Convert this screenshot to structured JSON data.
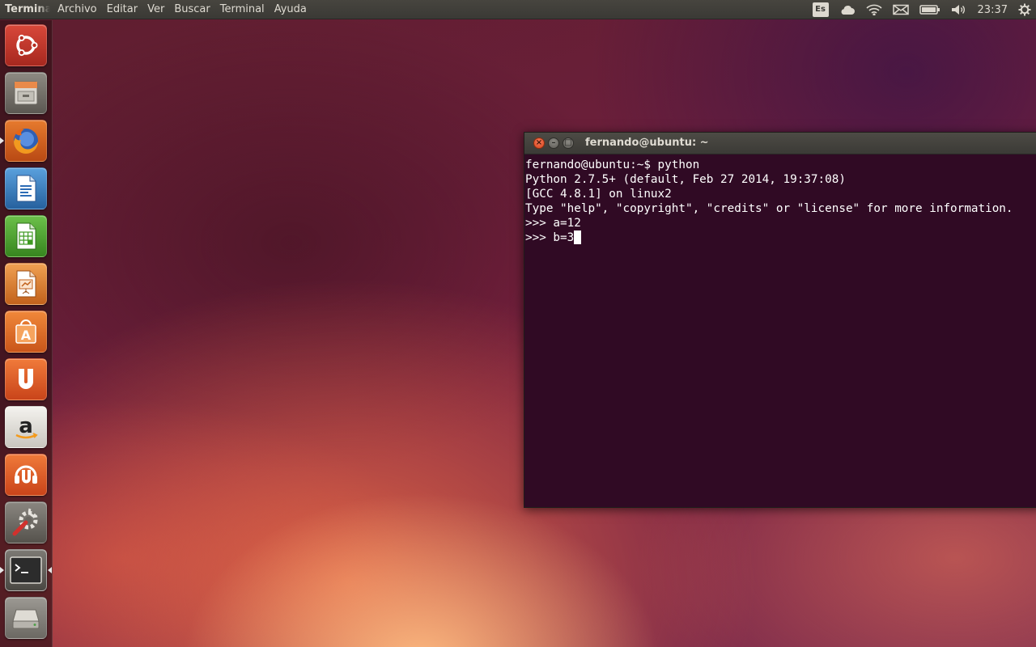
{
  "top_panel": {
    "app_title": "Terminal",
    "menus": [
      "Archivo",
      "Editar",
      "Ver",
      "Buscar",
      "Terminal",
      "Ayuda"
    ],
    "keyboard_layout": "Es",
    "clock": "23:37",
    "indicator_icons": [
      "cloud-icon",
      "wifi-icon",
      "mail-icon",
      "battery-icon",
      "volume-icon",
      "power-gear-icon"
    ]
  },
  "launcher": {
    "items": [
      {
        "name": "dash-home",
        "icon": "ubuntu-logo-icon"
      },
      {
        "name": "files",
        "icon": "file-cabinet-icon"
      },
      {
        "name": "firefox",
        "icon": "firefox-icon",
        "running": true
      },
      {
        "name": "libreoffice-writer",
        "icon": "writer-document-icon"
      },
      {
        "name": "libreoffice-calc",
        "icon": "calc-spreadsheet-icon"
      },
      {
        "name": "libreoffice-impress",
        "icon": "impress-presentation-icon"
      },
      {
        "name": "software-center",
        "icon": "shopping-bag-icon"
      },
      {
        "name": "ubuntu-one",
        "icon": "ubuntu-one-icon"
      },
      {
        "name": "amazon",
        "icon": "amazon-icon"
      },
      {
        "name": "ubuntu-one-music",
        "icon": "ubuntu-one-music-icon"
      },
      {
        "name": "system-settings",
        "icon": "settings-wrench-icon"
      },
      {
        "name": "terminal",
        "icon": "terminal-icon",
        "running": true,
        "focused": true
      },
      {
        "name": "drive",
        "icon": "drive-icon"
      }
    ]
  },
  "terminal": {
    "title": "fernando@ubuntu: ~",
    "buttons": {
      "close": "×",
      "minimize": "–",
      "maximize": "□"
    },
    "lines": [
      "fernando@ubuntu:~$ python",
      "Python 2.7.5+ (default, Feb 27 2014, 19:37:08)",
      "[GCC 4.8.1] on linux2",
      "Type \"help\", \"copyright\", \"credits\" or \"license\" for more information.",
      ">>> a=12",
      ">>> b=3"
    ],
    "colors": {
      "background": "#300a24",
      "foreground": "#ffffff"
    }
  }
}
